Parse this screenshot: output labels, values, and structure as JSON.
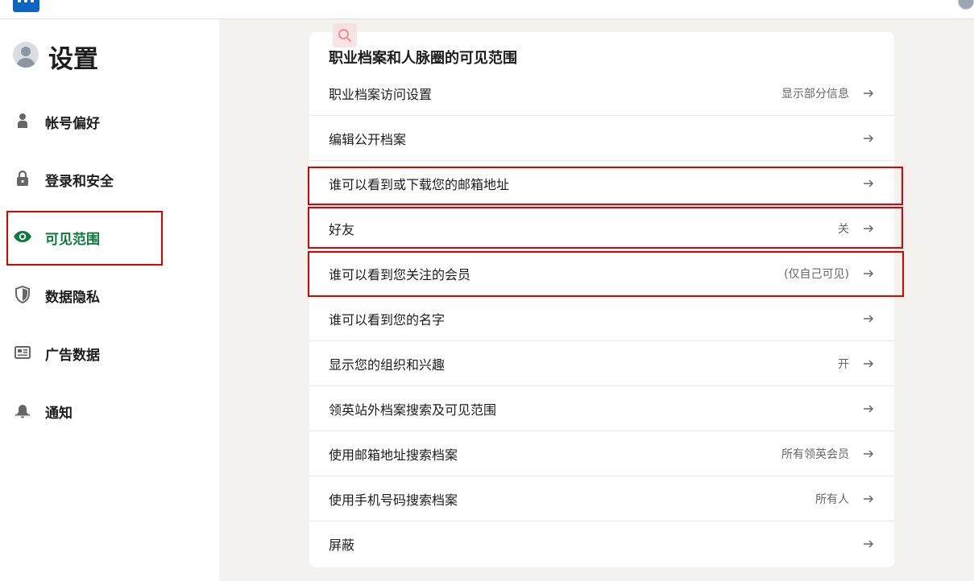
{
  "topbar": {
    "logo_icon": "linkedin-logo",
    "avatar_icon": "profile-avatar"
  },
  "sidebar": {
    "title": "设置",
    "items": [
      {
        "label": "帐号偏好",
        "icon": "person-icon",
        "active": false
      },
      {
        "label": "登录和安全",
        "icon": "lock-icon",
        "active": false
      },
      {
        "label": "可见范围",
        "icon": "eye-icon",
        "active": true
      },
      {
        "label": "数据隐私",
        "icon": "shield-icon",
        "active": false
      },
      {
        "label": "广告数据",
        "icon": "newspaper-icon",
        "active": false
      },
      {
        "label": "通知",
        "icon": "bell-icon",
        "active": false
      }
    ]
  },
  "section": {
    "title": "职业档案和人脉圈的可见范围",
    "rows": [
      {
        "label": "职业档案访问设置",
        "value": "显示部分信息"
      },
      {
        "label": "编辑公开档案",
        "value": ""
      },
      {
        "label": "谁可以看到或下载您的邮箱地址",
        "value": ""
      },
      {
        "label": "好友",
        "value": "关"
      },
      {
        "label": "谁可以看到您关注的会员",
        "value": "(仅自己可见)"
      },
      {
        "label": "谁可以看到您的名字",
        "value": ""
      },
      {
        "label": "显示您的组织和兴趣",
        "value": "开"
      },
      {
        "label": "领英站外档案搜索及可见范围",
        "value": ""
      },
      {
        "label": "使用邮箱地址搜索档案",
        "value": "所有领英会员"
      },
      {
        "label": "使用手机号码搜索档案",
        "value": "所有人"
      },
      {
        "label": "屏蔽",
        "value": ""
      }
    ]
  },
  "colors": {
    "active_nav": "#0a7a3e",
    "brand": "#0a66c2",
    "highlight": "#e00000"
  }
}
